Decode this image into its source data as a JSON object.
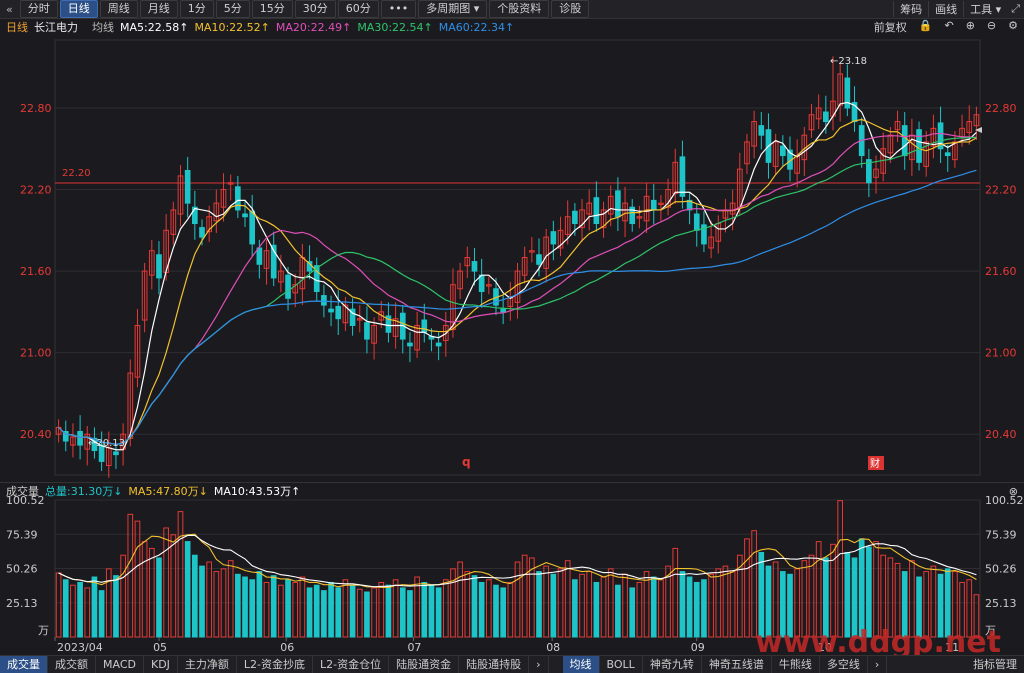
{
  "toolbar": {
    "back_glyph": "«",
    "items": [
      "分时",
      "日线",
      "周线",
      "月线",
      "1分",
      "5分",
      "15分",
      "30分",
      "60分",
      "•••",
      "多周期图 ▾",
      "个股资料",
      "诊股"
    ],
    "active_index": 1,
    "right_items": [
      "筹码",
      "画线",
      "工具 ▾"
    ]
  },
  "ma_bar": {
    "period": "日线",
    "stock_name": "长江电力",
    "avg_label": "均线",
    "ma5": "MA5:22.58↑",
    "ma10": "MA10:22.52↑",
    "ma20": "MA20:22.49↑",
    "ma30": "MA30:22.54↑",
    "ma60": "MA60:22.34↑",
    "adjust_label": "前复权"
  },
  "price_chart": {
    "y_ticks": [
      "22.80",
      "22.20",
      "21.60",
      "21.00",
      "20.40"
    ],
    "hline_label": "22.20",
    "high_annotation": "←23.18",
    "low_annotation": "←20.13",
    "marker_q": "q",
    "marker_cai": "财"
  },
  "volume_bar": {
    "title": "成交量",
    "total": "总量:31.30万↓",
    "ma5": "MA5:47.80万↓",
    "ma10": "MA10:43.53万↑"
  },
  "volume_chart": {
    "y_ticks": [
      "100.52",
      "75.39",
      "50.26",
      "25.13"
    ],
    "unit": "万"
  },
  "x_axis": {
    "labels": [
      "2023/04",
      "05",
      "06",
      "07",
      "08",
      "09",
      "10",
      "11"
    ]
  },
  "bottom_tabs": {
    "left": [
      "成交量",
      "成交额",
      "MACD",
      "KDJ",
      "主力净额",
      "L2-资金抄底",
      "L2-资金仓位",
      "陆股通资金",
      "陆股通持股"
    ],
    "right": [
      "均线",
      "BOLL",
      "神奇九转",
      "神奇五线谱",
      "牛熊线",
      "多空线"
    ],
    "right_last": "指标管理",
    "left_active": 0,
    "right_active": 0
  },
  "watermark": "www.ddgp.net",
  "colors": {
    "up": "#e53935",
    "down": "#1ec5c8",
    "ma5": "#ffffff",
    "ma10": "#f2c12e",
    "ma20": "#e04fb8",
    "ma30": "#2ec46a",
    "ma60": "#2f8fe8",
    "accent": "#2b4f86"
  },
  "chart_data": {
    "type": "candlestick",
    "price_ylim": [
      20.1,
      23.3
    ],
    "volume_ylim": [
      0,
      100.52
    ],
    "reference_line": 22.2,
    "high": 23.18,
    "low": 20.13,
    "closes": [
      20.45,
      20.35,
      20.38,
      20.32,
      20.4,
      20.28,
      20.2,
      20.3,
      20.25,
      20.4,
      20.85,
      21.2,
      21.6,
      21.75,
      21.55,
      21.9,
      22.05,
      22.3,
      22.1,
      21.95,
      21.85,
      22.0,
      22.1,
      22.2,
      22.25,
      22.05,
      22.0,
      21.8,
      21.65,
      21.75,
      21.55,
      21.6,
      21.4,
      21.5,
      21.7,
      21.6,
      21.45,
      21.35,
      21.3,
      21.25,
      21.35,
      21.2,
      21.25,
      21.1,
      21.2,
      21.3,
      21.15,
      21.25,
      21.1,
      21.05,
      21.2,
      21.15,
      21.1,
      21.05,
      21.2,
      21.5,
      21.6,
      21.7,
      21.6,
      21.45,
      21.5,
      21.35,
      21.3,
      21.4,
      21.6,
      21.7,
      21.75,
      21.65,
      21.85,
      21.8,
      21.9,
      22.0,
      21.95,
      22.05,
      22.1,
      21.95,
      22.05,
      22.15,
      22.0,
      22.1,
      21.95,
      22.0,
      22.15,
      22.05,
      22.1,
      22.2,
      22.4,
      22.15,
      22.05,
      21.9,
      21.8,
      21.85,
      21.95,
      22.05,
      22.1,
      22.35,
      22.55,
      22.7,
      22.6,
      22.4,
      22.55,
      22.45,
      22.35,
      22.45,
      22.6,
      22.75,
      22.8,
      22.7,
      22.85,
      23.05,
      22.8,
      22.7,
      22.45,
      22.25,
      22.35,
      22.5,
      22.6,
      22.7,
      22.45,
      22.6,
      22.4,
      22.55,
      22.65,
      22.5,
      22.45,
      22.55,
      22.65,
      22.7,
      22.75
    ],
    "volumes": [
      47,
      42,
      38,
      40,
      36,
      44,
      34,
      50,
      45,
      60,
      90,
      85,
      70,
      65,
      58,
      80,
      75,
      92,
      70,
      60,
      52,
      55,
      48,
      50,
      56,
      46,
      44,
      42,
      48,
      40,
      45,
      38,
      42,
      40,
      44,
      36,
      38,
      34,
      40,
      36,
      42,
      38,
      35,
      33,
      36,
      40,
      38,
      42,
      36,
      34,
      44,
      40,
      38,
      36,
      42,
      50,
      55,
      48,
      45,
      40,
      42,
      38,
      36,
      40,
      55,
      60,
      58,
      48,
      52,
      46,
      50,
      56,
      42,
      46,
      48,
      40,
      44,
      50,
      38,
      46,
      36,
      40,
      48,
      44,
      42,
      52,
      65,
      48,
      44,
      40,
      42,
      46,
      50,
      52,
      48,
      60,
      72,
      78,
      62,
      52,
      55,
      48,
      46,
      50,
      56,
      60,
      70,
      58,
      68,
      100,
      62,
      58,
      72,
      66,
      70,
      60,
      58,
      54,
      48,
      56,
      44,
      48,
      52,
      46,
      50,
      48,
      40,
      42,
      31
    ]
  }
}
